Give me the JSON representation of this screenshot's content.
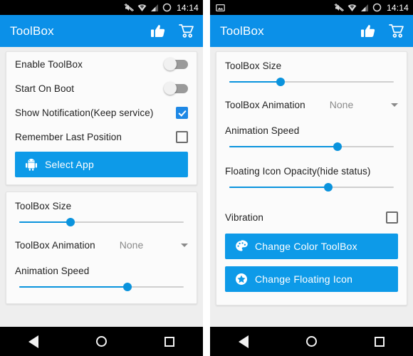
{
  "app": {
    "name": "ToolBox",
    "accent_blue": "#0b90e8",
    "button_blue": "#0d9ae8",
    "slider_blue": "#0a93dd",
    "card_bg": "#fbfbfb",
    "page_bg": "#eeeeee"
  },
  "left_phone": {
    "statusbar": {
      "time": "14:14",
      "icons": [
        "mute-icon",
        "wifi-icon",
        "signal-icon",
        "battery-icon"
      ]
    },
    "appbar": {
      "title": "ToolBox",
      "actions": [
        "thumbs-up-icon",
        "shopping-cart-icon"
      ]
    },
    "card_one": {
      "rows": [
        {
          "label": "Enable ToolBox",
          "control": "switch",
          "value": "off"
        },
        {
          "label": "Start On Boot",
          "control": "switch",
          "value": "off"
        },
        {
          "label": "Show Notification(Keep service)",
          "control": "checkbox",
          "value": "checked"
        },
        {
          "label": "Remember Last Position",
          "control": "checkbox",
          "value": "unchecked"
        }
      ],
      "select_app_button": {
        "label": "Select App",
        "icon": "android-robot-icon"
      }
    },
    "card_two": {
      "toolbox_size": {
        "label": "ToolBox Size",
        "percent": 31
      },
      "toolbox_animation": {
        "label": "ToolBox Animation",
        "value": "None"
      },
      "animation_speed": {
        "label": "Animation Speed",
        "percent": 66
      }
    },
    "navbar": {
      "back": "back-icon",
      "home": "home-icon",
      "recents": "recents-icon"
    }
  },
  "right_phone": {
    "statusbar": {
      "time": "14:14",
      "notification_icon": "screenshot-icon",
      "icons": [
        "mute-icon",
        "wifi-icon",
        "signal-icon",
        "battery-icon"
      ]
    },
    "appbar": {
      "title": "ToolBox",
      "actions": [
        "thumbs-up-icon",
        "shopping-cart-icon"
      ]
    },
    "card": {
      "toolbox_size": {
        "label": "ToolBox Size",
        "percent": 31
      },
      "toolbox_animation": {
        "label": "ToolBox Animation",
        "value": "None"
      },
      "animation_speed": {
        "label": "Animation Speed",
        "percent": 66
      },
      "floating_icon_opacity": {
        "label": "Floating Icon Opacity(hide status)",
        "percent": 60
      },
      "vibration": {
        "label": "Vibration",
        "control": "checkbox",
        "value": "unchecked"
      },
      "change_color_button": {
        "label": "Change Color ToolBox",
        "icon": "palette-icon"
      },
      "change_floating_icon_button": {
        "label": "Change Floating Icon",
        "icon": "star-icon"
      }
    },
    "navbar": {
      "back": "back-icon",
      "home": "home-icon",
      "recents": "recents-icon"
    }
  }
}
